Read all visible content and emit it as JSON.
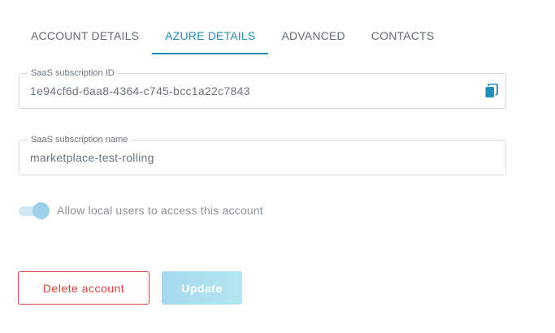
{
  "tabs": [
    {
      "label": "ACCOUNT DETAILS",
      "active": false
    },
    {
      "label": "AZURE DETAILS",
      "active": true
    },
    {
      "label": "ADVANCED",
      "active": false
    },
    {
      "label": "CONTACTS",
      "active": false
    }
  ],
  "subscription_id": {
    "label": "SaaS subscription ID",
    "value": "1e94cf6d-6aa8-4364-c745-bcc1a22c7843",
    "icon": "copy-icon"
  },
  "subscription_name": {
    "label": "SaaS subscription name",
    "value": "marketplace-test-rolling"
  },
  "local_users_toggle": {
    "label": "Allow local users to access this account",
    "enabled": true
  },
  "actions": {
    "delete_label": "Delete account",
    "update_label": "Update"
  },
  "colors": {
    "accent": "#1e8fb8",
    "danger": "#d9443a",
    "toggle_knob": "#9fd2e9"
  }
}
